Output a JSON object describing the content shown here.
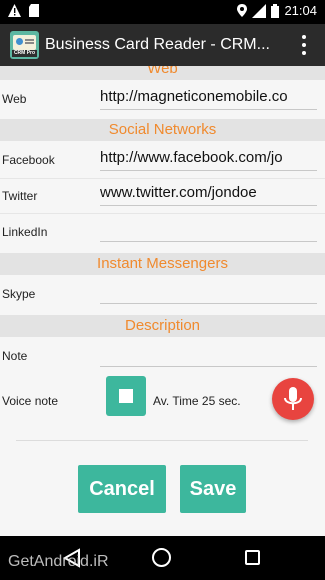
{
  "status_bar": {
    "time": "21:04",
    "network": "3G"
  },
  "action_bar": {
    "title": "Business Card Reader - CRM...",
    "app_icon_badge": "CRM Pro"
  },
  "sections": {
    "web": "Web",
    "social": "Social Networks",
    "messengers": "Instant Messengers",
    "description": "Description"
  },
  "fields": {
    "web": {
      "label": "Web",
      "value": "http://magneticonemobile.co"
    },
    "facebook": {
      "label": "Facebook",
      "value": "http://www.facebook.com/jo"
    },
    "twitter": {
      "label": "Twitter",
      "value": "www.twitter.com/jondoe"
    },
    "linkedin": {
      "label": "LinkedIn",
      "value": ""
    },
    "skype": {
      "label": "Skype",
      "value": ""
    },
    "note": {
      "label": "Note",
      "value": ""
    }
  },
  "voice_note": {
    "label": "Voice note",
    "avg_time": "Av. Time 25 sec."
  },
  "buttons": {
    "cancel": "Cancel",
    "save": "Save"
  },
  "watermark": "GetAndroid.iR",
  "colors": {
    "accent": "#3db79d",
    "section_text": "#f08a2e",
    "mic": "#e8443f"
  },
  "icons": [
    "warning-icon",
    "sd-card-icon",
    "location-icon",
    "signal-icon",
    "battery-icon",
    "overflow-menu-icon",
    "stop-icon",
    "microphone-icon",
    "back-icon",
    "home-icon",
    "recents-icon"
  ]
}
